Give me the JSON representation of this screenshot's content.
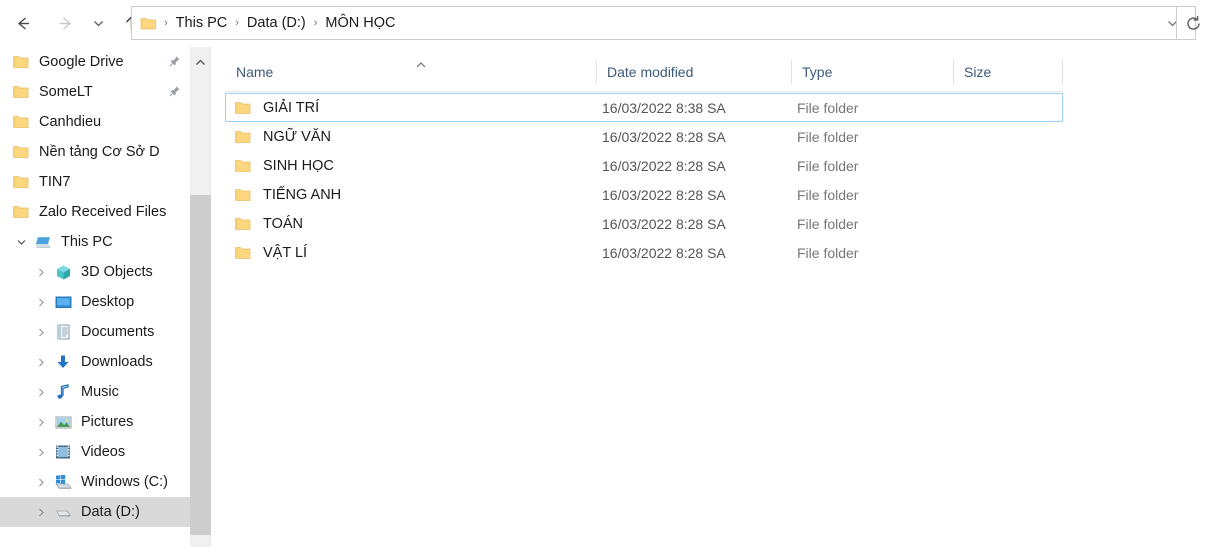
{
  "nav": {
    "back": {
      "label": "Back",
      "icon": "arrow-left-icon",
      "enabled": true
    },
    "forward": {
      "label": "Forward",
      "icon": "arrow-right-icon",
      "enabled": false
    },
    "recent": {
      "label": "Recent locations",
      "icon": "chevron-down-icon"
    },
    "up": {
      "label": "Up to Data (D:)",
      "icon": "arrow-up-icon"
    },
    "refresh": {
      "label": "Refresh",
      "icon": "refresh-icon"
    },
    "address_dropdown": {
      "label": "Previous locations",
      "icon": "chevron-down-icon"
    }
  },
  "address": {
    "folder_icon": "folder-icon",
    "crumbs": [
      {
        "label": "This PC"
      },
      {
        "label": "Data (D:)"
      },
      {
        "label": "MÔN HỌC"
      }
    ],
    "separator": "›"
  },
  "sidebar": {
    "quick_access": [
      {
        "label": "Google Drive",
        "icon": "folder-icon",
        "pinned": true
      },
      {
        "label": "SomeLT",
        "icon": "folder-icon",
        "pinned": true
      },
      {
        "label": "Canhdieu",
        "icon": "folder-icon",
        "pinned": false
      },
      {
        "label": "Nền tảng Cơ Sở D",
        "icon": "folder-icon",
        "pinned": false
      },
      {
        "label": "TIN7",
        "icon": "folder-icon",
        "pinned": false
      },
      {
        "label": "Zalo Received Files",
        "icon": "folder-icon",
        "pinned": false
      }
    ],
    "this_pc": {
      "label": "This PC",
      "icon": "computer-icon",
      "expanded": true
    },
    "this_pc_children": [
      {
        "label": "3D Objects",
        "icon": "3d-objects-icon",
        "selected": false
      },
      {
        "label": "Desktop",
        "icon": "desktop-icon",
        "selected": false
      },
      {
        "label": "Documents",
        "icon": "documents-icon",
        "selected": false
      },
      {
        "label": "Downloads",
        "icon": "downloads-icon",
        "selected": false
      },
      {
        "label": "Music",
        "icon": "music-icon",
        "selected": false
      },
      {
        "label": "Pictures",
        "icon": "pictures-icon",
        "selected": false
      },
      {
        "label": "Videos",
        "icon": "videos-icon",
        "selected": false
      },
      {
        "label": "Windows  (C:)",
        "icon": "windows-drive-icon",
        "selected": false
      },
      {
        "label": "Data (D:)",
        "icon": "drive-icon",
        "selected": true
      }
    ],
    "scrollbar": {
      "up_arrow": "chevron-up-icon"
    }
  },
  "file_list": {
    "columns": [
      {
        "key": "name",
        "label": "Name",
        "sorted": "asc"
      },
      {
        "key": "date",
        "label": "Date modified"
      },
      {
        "key": "type",
        "label": "Type"
      },
      {
        "key": "size",
        "label": "Size"
      }
    ],
    "rows": [
      {
        "name": "GIẢI TRÍ",
        "date": "16/03/2022 8:38 SA",
        "type": "File folder",
        "size": "",
        "icon": "folder-icon",
        "selected": true
      },
      {
        "name": "NGỮ VĂN",
        "date": "16/03/2022 8:28 SA",
        "type": "File folder",
        "size": "",
        "icon": "folder-icon",
        "selected": false
      },
      {
        "name": "SINH HỌC",
        "date": "16/03/2022 8:28 SA",
        "type": "File folder",
        "size": "",
        "icon": "folder-icon",
        "selected": false
      },
      {
        "name": "TIẾNG ANH",
        "date": "16/03/2022 8:28 SA",
        "type": "File folder",
        "size": "",
        "icon": "folder-icon",
        "selected": false
      },
      {
        "name": "TOÁN",
        "date": "16/03/2022 8:28 SA",
        "type": "File folder",
        "size": "",
        "icon": "folder-icon",
        "selected": false
      },
      {
        "name": "VẬT LÍ",
        "date": "16/03/2022 8:28 SA",
        "type": "File folder",
        "size": "",
        "icon": "folder-icon",
        "selected": false
      }
    ]
  },
  "colors": {
    "folder_yellow": "#fcd77f",
    "folder_yellow_dark": "#e8bf63",
    "selection_border": "#9fd1f5",
    "sidebar_selected_bg": "#d9d9d9",
    "header_text": "#3b5a7a",
    "scrollbar_thumb": "#cdcdcd",
    "accent_blue": "#0078d7"
  }
}
